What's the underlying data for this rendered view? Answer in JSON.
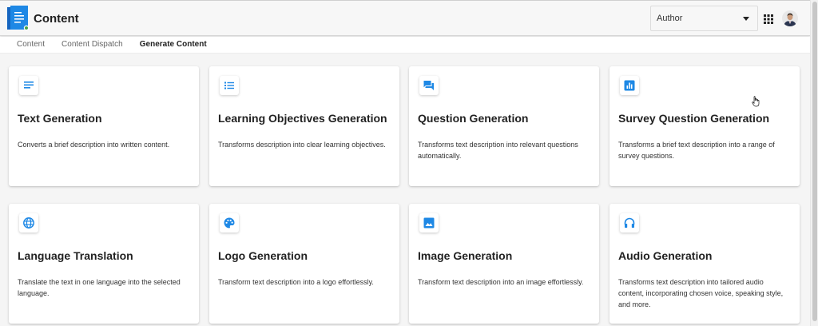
{
  "header": {
    "app_title": "Content",
    "role_select": {
      "value": "Author"
    }
  },
  "tabs": [
    {
      "label": "Content"
    },
    {
      "label": "Content Dispatch"
    },
    {
      "label": "Generate Content",
      "active": true
    }
  ],
  "cards": [
    {
      "icon": "text-lines-icon",
      "title": "Text Generation",
      "description": "Converts a brief description into written content."
    },
    {
      "icon": "bulleted-list-icon",
      "title": "Learning Objectives Generation",
      "description": "Transforms description into clear learning objectives."
    },
    {
      "icon": "question-chat-icon",
      "title": "Question Generation",
      "description": "Transforms text description into relevant questions automatically."
    },
    {
      "icon": "poll-chart-icon",
      "title": "Survey Question Generation",
      "description": "Transforms a brief text description into a range of survey questions."
    },
    {
      "icon": "globe-icon",
      "title": "Language Translation",
      "description": "Translate the text in one language into the selected language."
    },
    {
      "icon": "palette-icon",
      "title": "Logo Generation",
      "description": "Transform text description into a logo effortlessly."
    },
    {
      "icon": "image-icon",
      "title": "Image Generation",
      "description": "Transform text description into an image effortlessly."
    },
    {
      "icon": "headphones-icon",
      "title": "Audio Generation",
      "description": "Transforms text description into tailored audio content, incorporating chosen voice, speaking style, and more."
    }
  ],
  "colors": {
    "accent": "#1e88e5",
    "logo": "#1976d2"
  }
}
